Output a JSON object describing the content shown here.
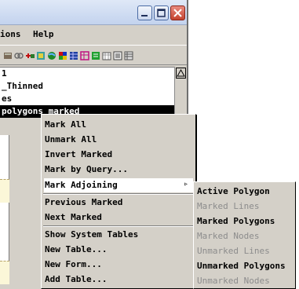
{
  "window": {
    "buttons": {
      "minimize": "minimize",
      "maximize": "maximize",
      "close": "close"
    }
  },
  "menubar": {
    "items": [
      "ions",
      "Help"
    ]
  },
  "toolbar": {
    "icons": [
      "table-icon",
      "link-icon",
      "edit-icon",
      "globe-icon",
      "grid-icon",
      "query-icon",
      "table-color-icon",
      "form-icon",
      "list-icon",
      "sheet-icon"
    ]
  },
  "list": {
    "rows": [
      {
        "label": "1",
        "selected": false
      },
      {
        "label": "_Thinned",
        "selected": false
      },
      {
        "label": "es",
        "selected": false
      },
      {
        "label": " polygons marked",
        "selected": true
      }
    ]
  },
  "popup": {
    "items": [
      {
        "label": "Mark All"
      },
      {
        "label": "Unmark All"
      },
      {
        "label": "Invert Marked"
      },
      {
        "label": "Mark by Query..."
      },
      {
        "label": "Mark Adjoining",
        "submenu": true
      },
      {
        "label": "Previous Marked"
      },
      {
        "label": "Next Marked"
      },
      {
        "label": "Show System Tables"
      },
      {
        "label": "New Table..."
      },
      {
        "label": "New Form..."
      },
      {
        "label": "Add Table..."
      }
    ]
  },
  "submenu": {
    "items": [
      {
        "label": "Active Polygon",
        "enabled": true
      },
      {
        "label": "Marked Lines",
        "enabled": false
      },
      {
        "label": "Marked Polygons",
        "enabled": true
      },
      {
        "label": "Marked Nodes",
        "enabled": false
      },
      {
        "label": "Unmarked Lines",
        "enabled": false
      },
      {
        "label": "Unmarked Polygons",
        "enabled": true
      },
      {
        "label": "Unmarked Nodes",
        "enabled": false
      }
    ]
  },
  "colors": {
    "selection": "#000000",
    "menu_bg": "#d4d0c8",
    "disabled_text": "#8c8c8c",
    "close_button": "#c4432f"
  }
}
